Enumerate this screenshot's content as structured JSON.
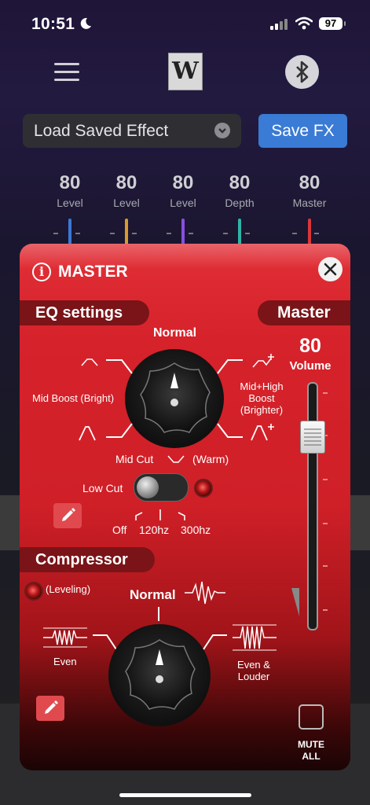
{
  "status_bar": {
    "time": "10:51",
    "battery": "97"
  },
  "top_bar": {
    "logo_letter": "W"
  },
  "effect_bar": {
    "load_label": "Load Saved Effect",
    "save_label": "Save FX"
  },
  "knobs": [
    {
      "value": "80",
      "label": "Level",
      "color": "#3b78d6"
    },
    {
      "value": "80",
      "label": "Level",
      "color": "#d79a2b"
    },
    {
      "value": "80",
      "label": "Level",
      "color": "#8a4ee0"
    },
    {
      "value": "80",
      "label": "Depth",
      "color": "#2fb3a8"
    },
    {
      "value": "80",
      "label": "Master",
      "color": "#d9363a"
    }
  ],
  "master_panel": {
    "title": "MASTER",
    "eq": {
      "heading": "EQ settings",
      "position_top": "Normal",
      "position_left": "Mid Boost (Bright)",
      "position_right": "Mid+High Boost (Brighter)",
      "position_bottom_left": "Mid Cut",
      "position_bottom_right": "(Warm)",
      "low_cut_label": "Low Cut",
      "low_cut_options": [
        "Off",
        "120hz",
        "300hz"
      ]
    },
    "master": {
      "heading": "Master",
      "volume_value": "80",
      "volume_label": "Volume",
      "mute_label": "MUTE ALL"
    },
    "compressor": {
      "heading": "Compressor",
      "indicator_label": "(Leveling)",
      "position_top": "Normal",
      "position_left": "Even",
      "position_right": "Even & Louder"
    }
  }
}
